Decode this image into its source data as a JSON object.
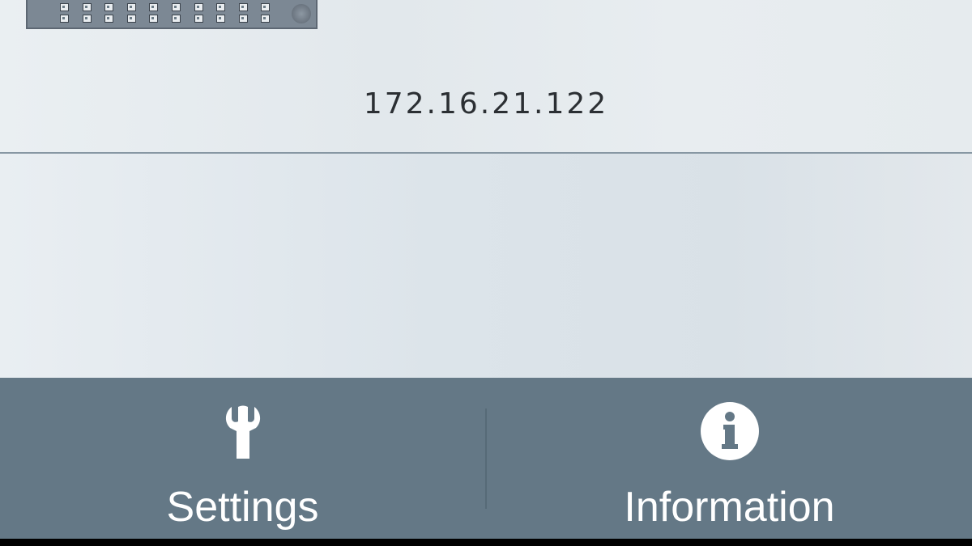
{
  "device": {
    "ip_address": "172.16.21.122"
  },
  "nav": {
    "settings": {
      "label": "Settings",
      "icon": "wrench-icon"
    },
    "information": {
      "label": "Information",
      "icon": "info-icon"
    }
  },
  "colors": {
    "bottom_bar": "#647886",
    "divider": "#8797a3",
    "icon": "#ffffff"
  }
}
